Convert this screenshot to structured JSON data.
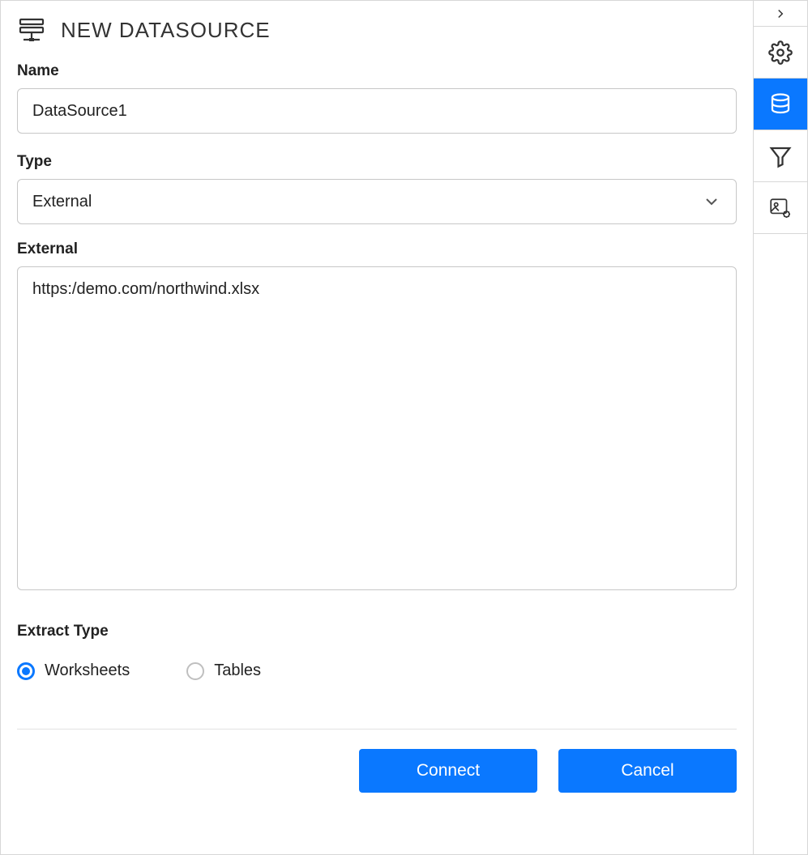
{
  "header": {
    "title": "NEW DATASOURCE"
  },
  "form": {
    "name_label": "Name",
    "name_value": "DataSource1",
    "type_label": "Type",
    "type_value": "External",
    "external_label": "External",
    "external_value": "https:/demo.com/northwind.xlsx",
    "extract_type_label": "Extract Type",
    "radio_worksheets": "Worksheets",
    "radio_tables": "Tables",
    "connect_label": "Connect",
    "cancel_label": "Cancel"
  },
  "toolbar": {
    "items": [
      {
        "name": "expand-icon"
      },
      {
        "name": "settings-icon"
      },
      {
        "name": "datasource-icon",
        "active": true
      },
      {
        "name": "filter-icon"
      },
      {
        "name": "image-settings-icon"
      }
    ]
  }
}
